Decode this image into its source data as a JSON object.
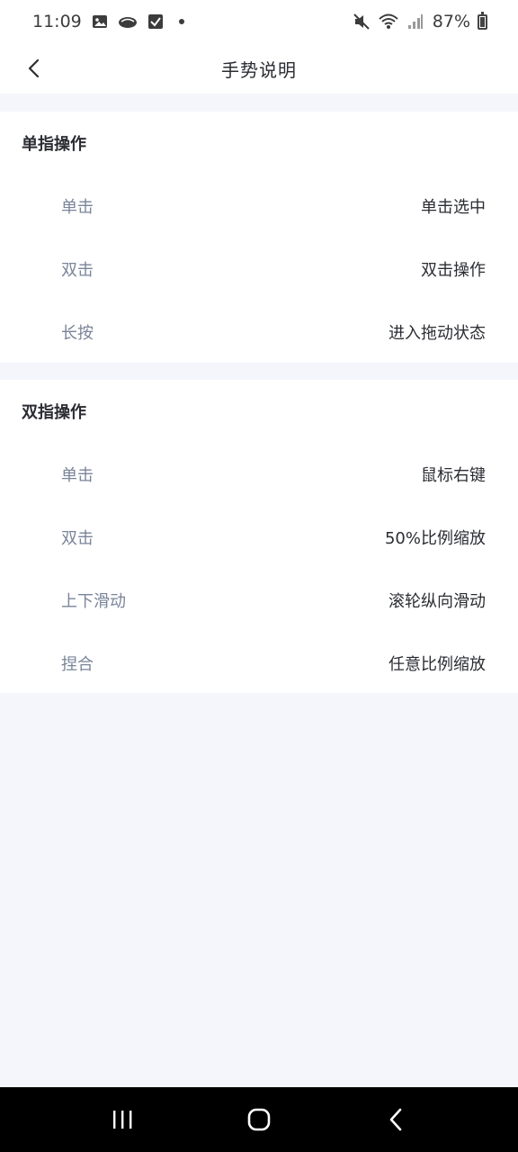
{
  "status_bar": {
    "time": "11:09",
    "battery_pct": "87%",
    "icons_left": [
      "image-icon",
      "cloud-icon",
      "checkbox-icon",
      "notification-dot-icon"
    ],
    "icons_right": [
      "mute-icon",
      "wifi-icon",
      "signal-icon",
      "battery-icon"
    ]
  },
  "header": {
    "title": "手势说明",
    "back_icon": "chevron-left-icon"
  },
  "sections": [
    {
      "title": "单指操作",
      "rows": [
        {
          "gesture": "单击",
          "action": "单击选中"
        },
        {
          "gesture": "双击",
          "action": "双击操作"
        },
        {
          "gesture": "长按",
          "action": "进入拖动状态"
        }
      ]
    },
    {
      "title": "双指操作",
      "rows": [
        {
          "gesture": "单击",
          "action": "鼠标右键"
        },
        {
          "gesture": "双击",
          "action": "50%比例缩放"
        },
        {
          "gesture": "上下滑动",
          "action": "滚轮纵向滑动"
        },
        {
          "gesture": "捏合",
          "action": "任意比例缩放"
        }
      ]
    }
  ],
  "system_nav": {
    "icons": [
      "recent-apps-icon",
      "home-icon",
      "back-icon"
    ]
  }
}
